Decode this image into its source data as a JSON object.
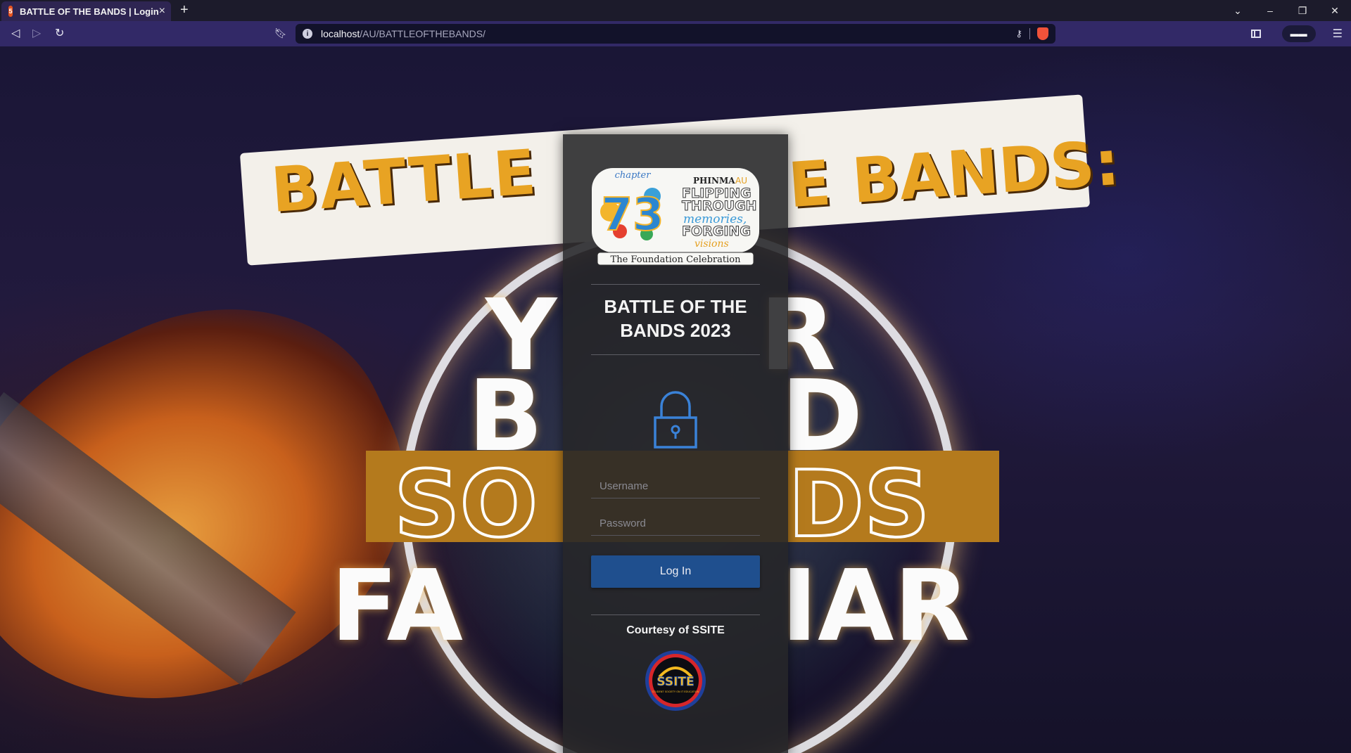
{
  "browser": {
    "tab": {
      "title": "BATTLE OF THE BANDS | Login",
      "favicon": "html5-icon"
    },
    "new_tab_symbol": "+",
    "url": {
      "host": "localhost",
      "path": "/AU/BATTLEOFTHEBANDS/"
    },
    "window_controls": [
      "⌄",
      "–",
      "❐",
      "✕"
    ]
  },
  "background": {
    "banner_left": "BATTLE",
    "banner_right": "E BANDS:",
    "line1": [
      "Y",
      "R"
    ],
    "line2": [
      "B",
      "D"
    ],
    "line3": [
      "SO",
      "DS"
    ],
    "line4": [
      "FA",
      "IAR"
    ]
  },
  "card": {
    "logo": {
      "chapter": "chapter",
      "number": "73",
      "org": "PHINMA",
      "org_accent": "AU",
      "line1": "FLIPPING",
      "line2": "THROUGH",
      "line3": "memories,",
      "line4": "FORGING",
      "line5": "visions",
      "ribbon": "The Foundation Celebration"
    },
    "title": "BATTLE OF THE BANDS 2023",
    "username_placeholder": "Username",
    "password_placeholder": "Password",
    "login_label": "Log In",
    "courtesy": "Courtesy of SSITE",
    "ssite_text": "SSITE",
    "ssite_subtext": "STUDENT SOCIETY ON IT EDUCATION"
  },
  "colors": {
    "tab_bar": "#1c1b2b",
    "toolbar": "#322967",
    "card": "#252528",
    "button": "#1f4f8e",
    "lock": "#3a82d8",
    "banner_text": "#e8a323"
  }
}
